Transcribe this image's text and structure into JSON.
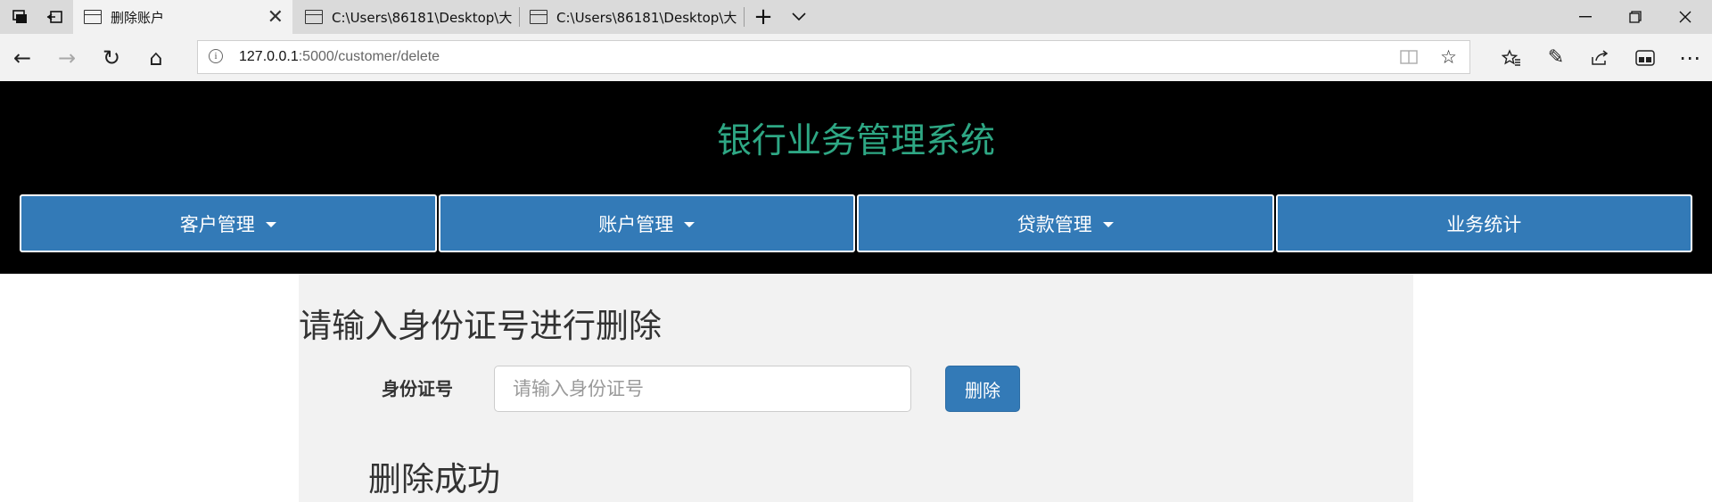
{
  "browser": {
    "tabs": [
      {
        "title": "删除账户",
        "active": true
      },
      {
        "title": "C:\\Users\\86181\\Desktop\\大",
        "active": false
      },
      {
        "title": "C:\\Users\\86181\\Desktop\\大",
        "active": false
      }
    ],
    "close_glyph": "✕",
    "new_tab_glyph": "+",
    "tab_list_glyph": "⌄",
    "address": {
      "host": "127.0.0.1",
      "rest": ":5000/customer/delete"
    },
    "icons": {
      "back": "←",
      "forward": "→",
      "refresh": "↻",
      "home": "⌂",
      "info": "i",
      "reading_view": "📖",
      "favorite": "☆",
      "favorites_hub": "☆",
      "notes": "✎",
      "share": "⇪",
      "extensions": "▣",
      "more": "⋯",
      "minimize": "—",
      "restore": "❐",
      "close": "✕"
    }
  },
  "site": {
    "title": "银行业务管理系统",
    "title_color": "#2ea784",
    "accent": "#337ab7",
    "nav": [
      {
        "label": "客户管理",
        "dropdown": true
      },
      {
        "label": "账户管理",
        "dropdown": true
      },
      {
        "label": "贷款管理",
        "dropdown": true
      },
      {
        "label": "业务统计",
        "dropdown": false
      }
    ]
  },
  "form": {
    "heading": "请输入身份证号进行删除",
    "id_label": "身份证号",
    "id_placeholder": "请输入身份证号",
    "id_value": "",
    "submit_label": "删除",
    "result_message": "删除成功"
  }
}
